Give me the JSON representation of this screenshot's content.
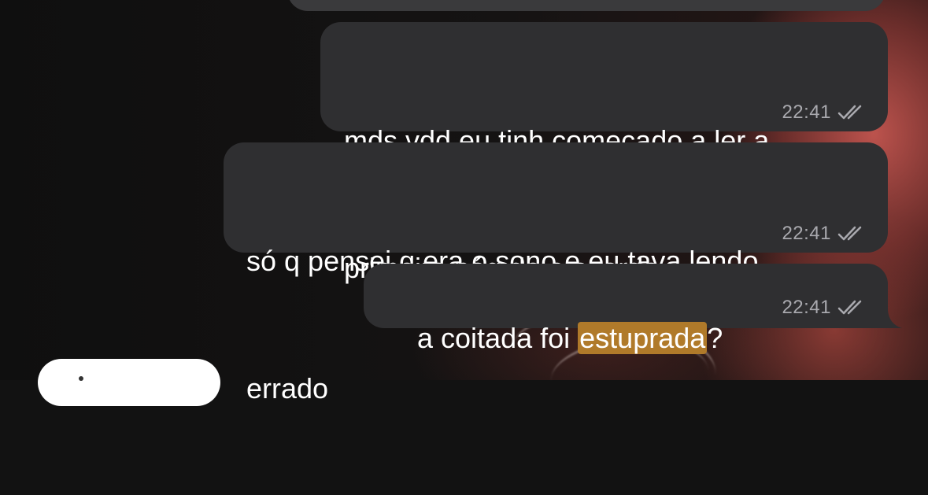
{
  "messages": [
    {
      "text_line1": "mds vdd eu tinh começado a ler a",
      "text_line2": "primeira pág de o acordo",
      "time": "22:41",
      "status": "read-double-check"
    },
    {
      "text_line1": "só q pensei q era o sono e eu tava lendo",
      "text_line2": "errado",
      "time": "22:41",
      "status": "read-double-check"
    },
    {
      "text_before": "a coitada foi ",
      "highlight": "estuprada",
      "text_after": "?",
      "time": "22:41",
      "status": "read-double-check"
    }
  ],
  "colors": {
    "outgoing_bubble": "#2f2f31",
    "highlight": "#b07a2a",
    "timestamp": "#a9a9ae"
  },
  "icons": {
    "read_receipt": "double-check-icon"
  }
}
